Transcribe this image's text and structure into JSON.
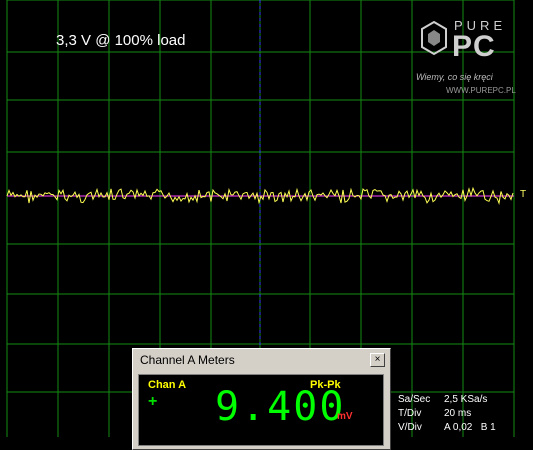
{
  "caption": "3,3 V @ 100% load",
  "logo": {
    "brand_top": "PURE",
    "brand_big": "PC",
    "slogan": "Wiemy, co się kręci",
    "url": "WWW.PUREPC.PL"
  },
  "trigger_marker": "T",
  "meter": {
    "title": "Channel A Meters",
    "close_label": "×",
    "channel_label": "Chan A",
    "measure_label": "Pk-Pk",
    "sign": "+",
    "value": "9.400",
    "unit": "mV"
  },
  "settings": {
    "rows": [
      {
        "key": "Sa/Sec",
        "value": "2,5 KSa/s"
      },
      {
        "key": "T/Div",
        "value": "20 ms"
      },
      {
        "key": "V/Div",
        "value": "A 0,02   B 1"
      }
    ]
  },
  "colors": {
    "grid": "#138a13",
    "trace": "#ffff55",
    "reference": "#ff40ff",
    "center_axis": "#3a3aff"
  }
}
